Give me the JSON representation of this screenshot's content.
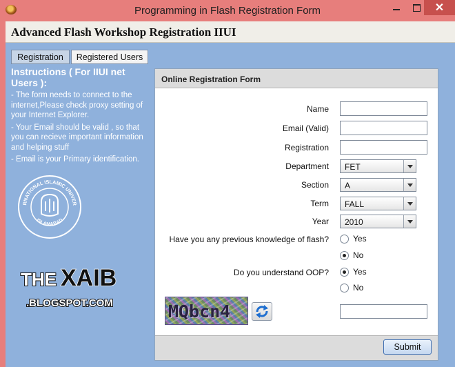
{
  "window": {
    "title": "Programming in Flash Registration Form",
    "close_glyph": "✕"
  },
  "heading": "Advanced Flash Workshop Registration IIUI",
  "tabs": [
    "Registration",
    "Registered Users"
  ],
  "instructions": {
    "title": "Instructions ( For IIUI net Users ):",
    "lines": [
      "- The form needs to connect to the internet,Please check proxy setting of your Internet Explorer.",
      "- Your Email should be valid , so that you can recieve important information and helping stuff",
      "- Email is your Primary identification."
    ]
  },
  "logo": {
    "top_text": "INTERNATIONAL ISLAMIC UNIVERSITY",
    "bottom_text": "ISLAMABAD"
  },
  "blog_logo": {
    "text_the": "THE",
    "text_xaib": "XAIB",
    "text_domain": ".BLOGSPOT.COM"
  },
  "form": {
    "title": "Online Registration Form",
    "labels": {
      "name": "Name",
      "email": "Email (Valid)",
      "registration": "Registration",
      "department": "Department",
      "section": "Section",
      "term": "Term",
      "year": "Year",
      "flash_question": "Have you any previous knowledge of flash?",
      "oop_question": "Do you understand OOP?"
    },
    "values": {
      "name": "",
      "email": "",
      "registration": "",
      "captcha_input": ""
    },
    "selects": {
      "department": "FET",
      "section": "A",
      "term": "FALL",
      "year": "2010"
    },
    "flash_options": [
      "Yes",
      "No"
    ],
    "flash_selected": "No",
    "oop_options": [
      "Yes",
      "No"
    ],
    "oop_selected": "Yes",
    "captcha_text": "MQbcn4",
    "submit_label": "Submit"
  }
}
